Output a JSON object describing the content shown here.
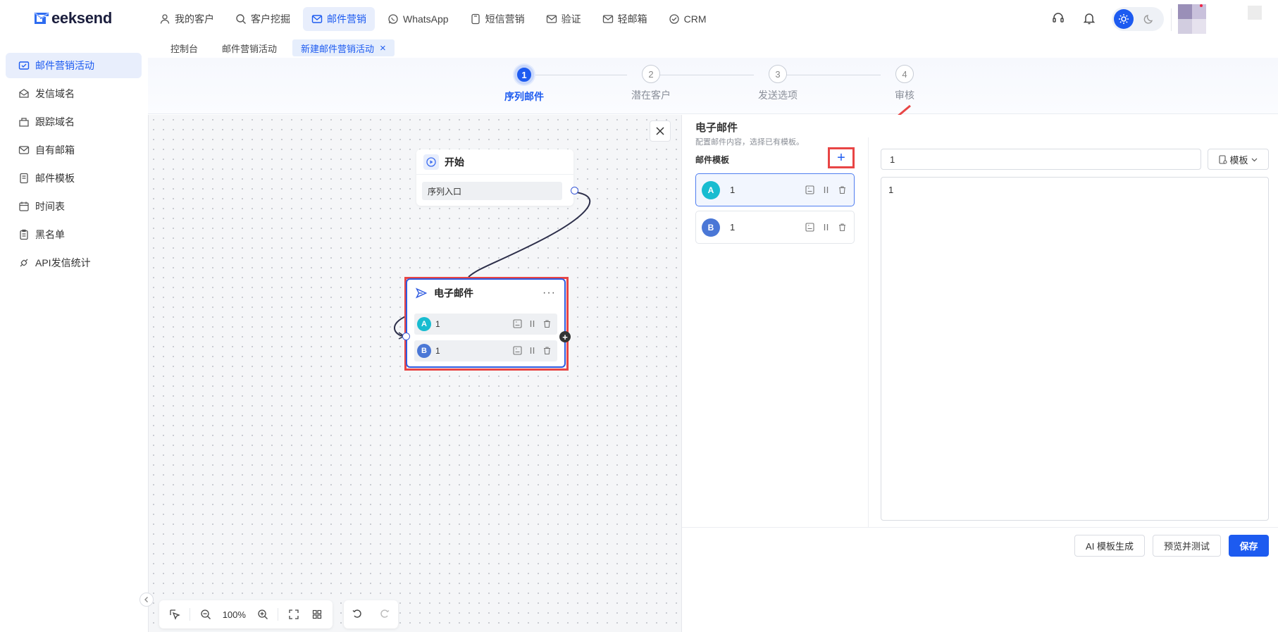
{
  "header": {
    "logo_text": "eeksend",
    "nav": [
      {
        "label": "我的客户",
        "icon": "user-icon"
      },
      {
        "label": "客户挖掘",
        "icon": "search-icon"
      },
      {
        "label": "邮件营销",
        "icon": "mail-icon",
        "active": true
      },
      {
        "label": "WhatsApp",
        "icon": "whatsapp-icon"
      },
      {
        "label": "短信营销",
        "icon": "sms-icon"
      },
      {
        "label": "验证",
        "icon": "verify-mail-icon"
      },
      {
        "label": "轻邮箱",
        "icon": "light-mail-icon"
      },
      {
        "label": "CRM",
        "icon": "crm-icon"
      }
    ]
  },
  "subtabs": [
    {
      "label": "控制台"
    },
    {
      "label": "邮件营销活动"
    },
    {
      "label": "新建邮件营销活动",
      "active": true,
      "close": "×"
    }
  ],
  "sidebar": {
    "items": [
      {
        "label": "邮件营销活动",
        "icon": "campaign-icon",
        "active": true
      },
      {
        "label": "发信域名",
        "icon": "send-domain-icon"
      },
      {
        "label": "跟踪域名",
        "icon": "track-domain-icon"
      },
      {
        "label": "自有邮箱",
        "icon": "own-mailbox-icon"
      },
      {
        "label": "邮件模板",
        "icon": "template-icon"
      },
      {
        "label": "时间表",
        "icon": "calendar-icon"
      },
      {
        "label": "黑名单",
        "icon": "blacklist-icon"
      },
      {
        "label": "API发信统计",
        "icon": "api-icon"
      }
    ]
  },
  "stepper": {
    "steps": [
      {
        "num": "1",
        "label": "序列邮件",
        "active": true
      },
      {
        "num": "2",
        "label": "潜在客户"
      },
      {
        "num": "3",
        "label": "发送选项"
      },
      {
        "num": "4",
        "label": "审核"
      }
    ]
  },
  "canvas": {
    "start_node": {
      "title": "开始",
      "entry_label": "序列入口"
    },
    "email_node": {
      "title": "电子邮件",
      "more": "···",
      "variants": [
        {
          "badge": "A",
          "name": "1"
        },
        {
          "badge": "B",
          "name": "1"
        }
      ]
    },
    "zoom": "100%",
    "plus": "+"
  },
  "panel": {
    "title": "电子邮件",
    "subtitle": "配置邮件内容，选择已有模板。",
    "templates_label": "邮件模板",
    "add_symbol": "+",
    "templates": [
      {
        "badge": "A",
        "name": "1",
        "active": true
      },
      {
        "badge": "B",
        "name": "1"
      }
    ],
    "subject_value": "1",
    "template_button": "模板",
    "body_value": "1",
    "buttons": {
      "ai": "AI 模板生成",
      "preview": "预览并测试",
      "save": "保存"
    }
  },
  "colors": {
    "accent": "#1d5bf0",
    "highlight": "#e84545",
    "badge_a": "#18bcd0",
    "badge_b": "#4a77d6"
  }
}
